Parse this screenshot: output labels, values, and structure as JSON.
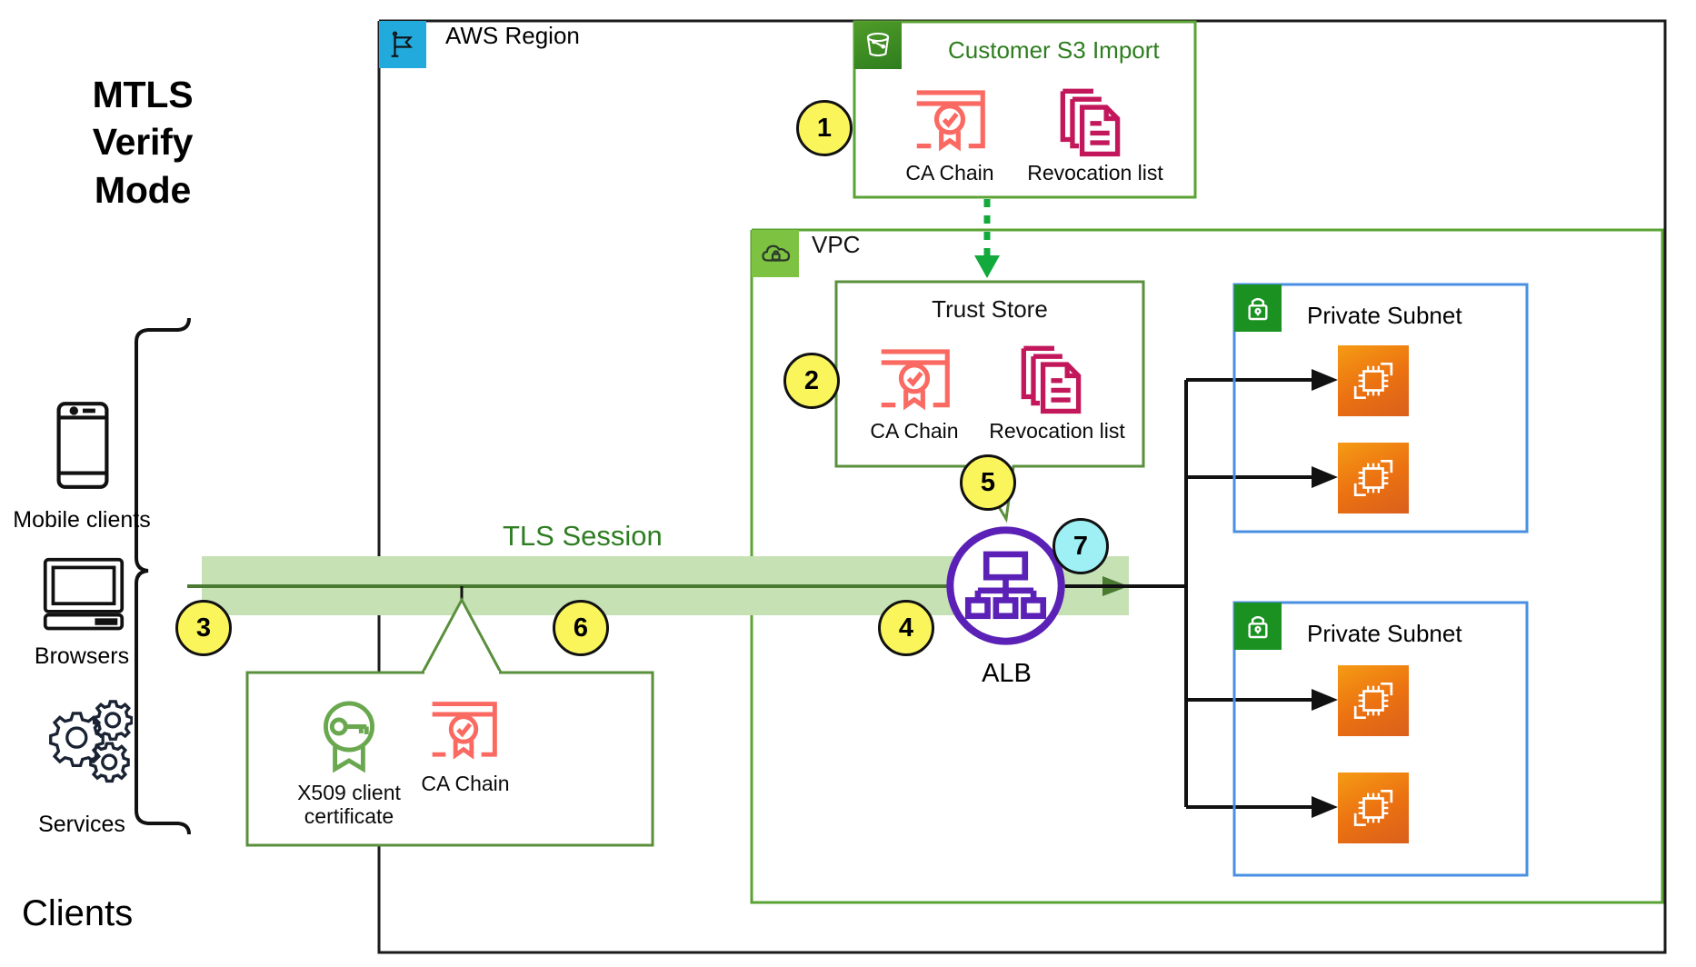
{
  "diagram": {
    "title_lines": [
      "MTLS",
      "Verify",
      "Mode"
    ],
    "clients_label": "Clients"
  },
  "region": {
    "label": "AWS Region",
    "icon": "region-flag-icon",
    "tile_color": "#22aadd"
  },
  "s3_import": {
    "title": "Customer S3 Import",
    "icon": "s3-bucket-icon",
    "border_color": "#5aa334",
    "title_color": "#2e7d1e",
    "items": [
      {
        "caption": "CA Chain",
        "icon": "certificate-icon",
        "color": "#fb6a62"
      },
      {
        "caption": "Revocation list",
        "icon": "documents-stack-icon",
        "color": "#c2185b"
      }
    ]
  },
  "vpc": {
    "label": "VPC",
    "icon": "vpc-cloud-lock-icon",
    "border_color": "#5aa334",
    "tile_color": "#7ec242"
  },
  "trust_store": {
    "title": "Trust Store",
    "border_color": "#5a8f3c",
    "items": [
      {
        "caption": "CA Chain",
        "icon": "certificate-icon",
        "color": "#fb6a62"
      },
      {
        "caption": "Revocation list",
        "icon": "documents-stack-icon",
        "color": "#c2185b"
      }
    ]
  },
  "alb": {
    "label": "ALB",
    "icon": "load-balancer-icon",
    "color": "#5b21b6"
  },
  "tls": {
    "label": "TLS Session",
    "band_color": "#c6e2b5",
    "arrow_color": "#4a7a32",
    "label_color": "#2f7d22"
  },
  "clients": [
    {
      "caption": "Mobile clients",
      "icon": "mobile-phone-icon"
    },
    {
      "caption": "Browsers",
      "icon": "desktop-computer-icon"
    },
    {
      "caption": "Services",
      "icon": "gears-icon"
    }
  ],
  "client_cert_callout": {
    "border_color": "#5a8f3c",
    "items": [
      {
        "caption_lines": [
          "X509 client",
          "certificate"
        ],
        "icon": "key-badge-icon",
        "color": "#6aa84f"
      },
      {
        "caption_lines": [
          "CA Chain"
        ],
        "icon": "certificate-icon",
        "color": "#fb6a62"
      }
    ]
  },
  "subnets": [
    {
      "label": "Private Subnet",
      "icon": "subnet-lock-icon",
      "border_color": "#4a90e2",
      "instances": [
        {
          "icon": "ec2-instance-icon"
        },
        {
          "icon": "ec2-instance-icon"
        }
      ]
    },
    {
      "label": "Private Subnet",
      "icon": "subnet-lock-icon",
      "border_color": "#4a90e2",
      "instances": [
        {
          "icon": "ec2-instance-icon"
        },
        {
          "icon": "ec2-instance-icon"
        }
      ]
    }
  ],
  "step_badges": [
    {
      "number": "1",
      "color": "yellow"
    },
    {
      "number": "2",
      "color": "yellow"
    },
    {
      "number": "3",
      "color": "yellow"
    },
    {
      "number": "4",
      "color": "yellow"
    },
    {
      "number": "5",
      "color": "yellow"
    },
    {
      "number": "6",
      "color": "yellow"
    },
    {
      "number": "7",
      "color": "cyan"
    }
  ],
  "import_arrow": {
    "style": "dotted",
    "color": "#12aa3c"
  }
}
